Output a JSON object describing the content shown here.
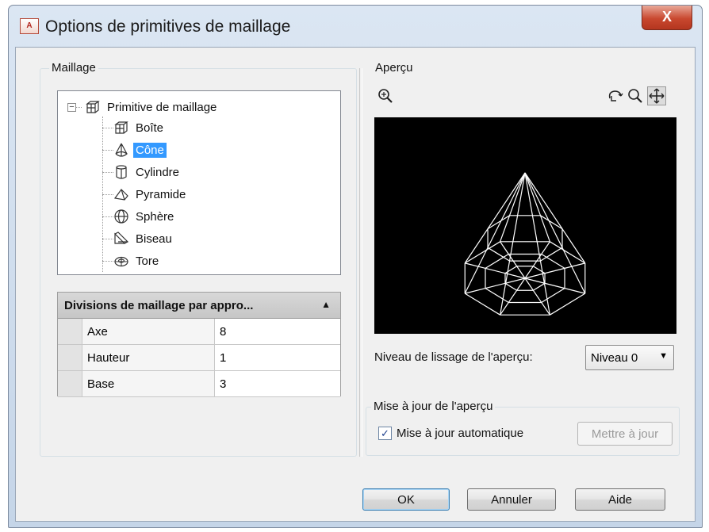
{
  "window": {
    "title": "Options de primitives de maillage",
    "icon_text": "A",
    "close_label": "X"
  },
  "mesh_group": {
    "label": "Maillage",
    "tree": {
      "root": {
        "label": "Primitive de maillage",
        "icon": "mesh-box-icon"
      },
      "items": [
        {
          "label": "Boîte",
          "icon": "box-icon",
          "selected": false
        },
        {
          "label": "Cône",
          "icon": "cone-icon",
          "selected": true
        },
        {
          "label": "Cylindre",
          "icon": "cylinder-icon",
          "selected": false
        },
        {
          "label": "Pyramide",
          "icon": "pyramid-icon",
          "selected": false
        },
        {
          "label": "Sphère",
          "icon": "sphere-icon",
          "selected": false
        },
        {
          "label": "Biseau",
          "icon": "wedge-icon",
          "selected": false
        },
        {
          "label": "Tore",
          "icon": "torus-icon",
          "selected": false
        }
      ]
    },
    "properties": {
      "header": "Divisions de maillage par appro...",
      "rows": [
        {
          "name": "Axe",
          "value": "8"
        },
        {
          "name": "Hauteur",
          "value": "1"
        },
        {
          "name": "Base",
          "value": "3"
        }
      ]
    }
  },
  "preview": {
    "label": "Aperçu",
    "tools": {
      "zoom_extents": "zoom-extents-icon",
      "orbit": "orbit-icon",
      "zoom": "zoom-icon",
      "pan": "pan-icon"
    },
    "smoothing_label": "Niveau de lissage de l'aperçu:",
    "smoothing_value": "Niveau 0",
    "update_group": {
      "label": "Mise à jour de l'aperçu",
      "auto_label": "Mise à jour automatique",
      "auto_checked": true,
      "update_button": "Mettre à jour"
    }
  },
  "buttons": {
    "ok": "OK",
    "cancel": "Annuler",
    "help": "Aide"
  },
  "colors": {
    "selection": "#3399ff",
    "preview_background": "#000000",
    "wireframe": "#ffffff"
  }
}
